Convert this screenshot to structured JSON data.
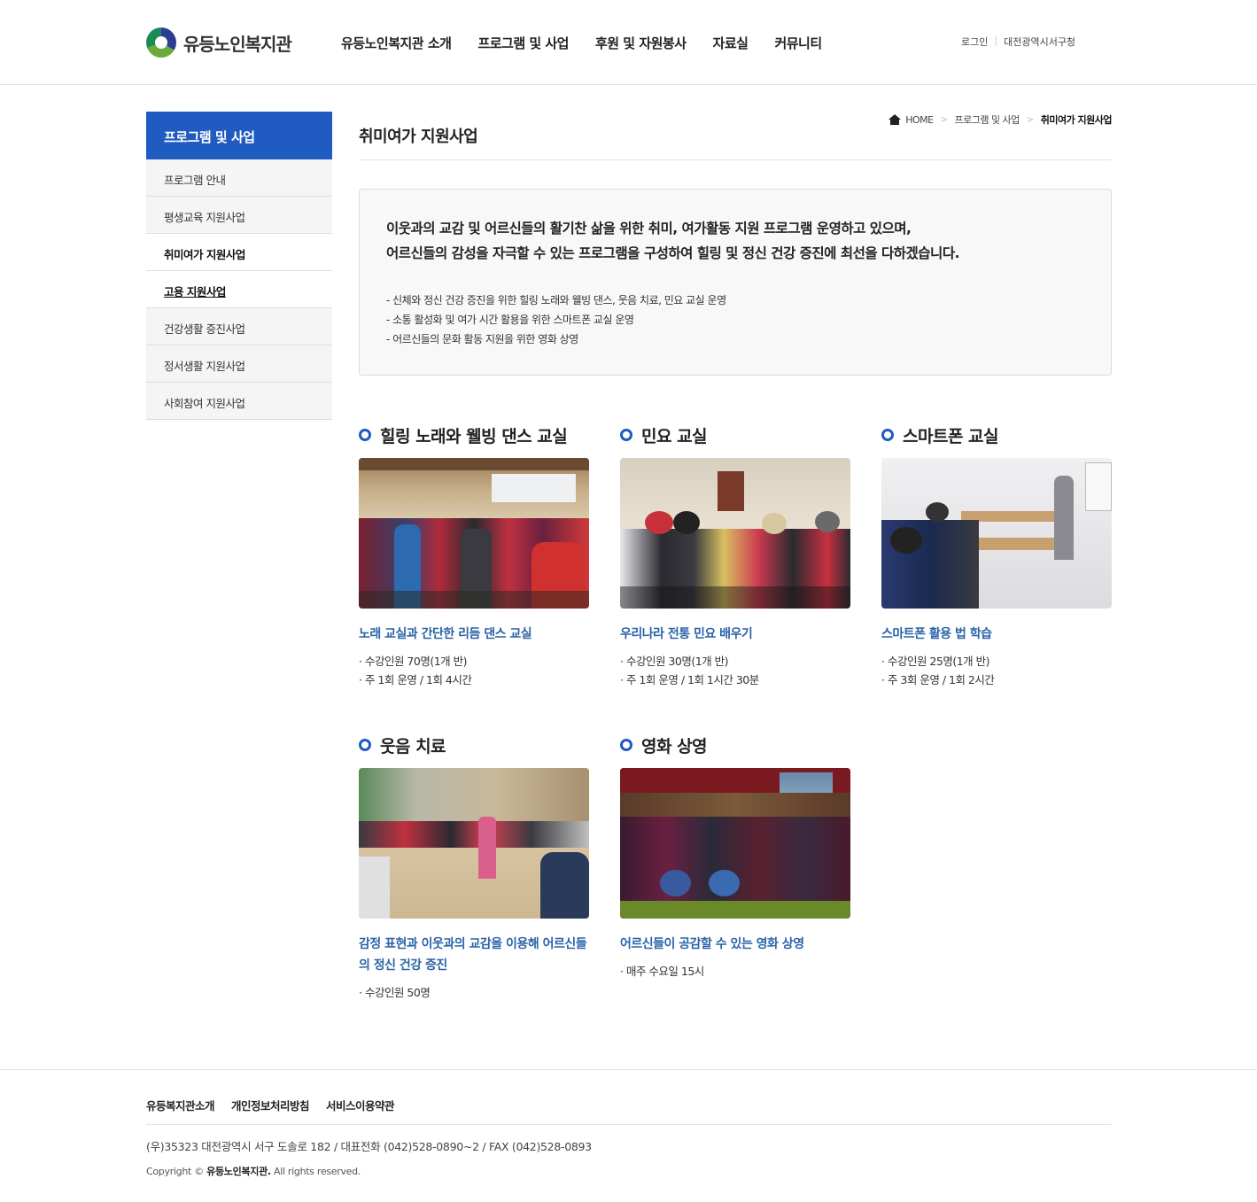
{
  "header": {
    "logo_text": "유등노인복지관",
    "nav": [
      "유등노인복지관 소개",
      "프로그램 및 사업",
      "후원 및 자원봉사",
      "자료실",
      "커뮤니티"
    ],
    "util": {
      "login": "로그인",
      "separator": "|",
      "link": "대전광역시서구청"
    }
  },
  "sidebar": {
    "title": "프로그램 및 사업",
    "items": [
      {
        "label": "프로그램 안내"
      },
      {
        "label": "평생교육 지원사업"
      },
      {
        "label": "취미여가 지원사업"
      },
      {
        "label": "고용 지원사업"
      },
      {
        "label": "건강생활 증진사업"
      },
      {
        "label": "정서생활 지원사업"
      },
      {
        "label": "사회참여 지원사업"
      }
    ]
  },
  "page": {
    "title": "취미여가 지원사업",
    "breadcrumb": {
      "home": "HOME",
      "parent": "프로그램 및 사업",
      "current": "취미여가 지원사업",
      "sep": ">"
    }
  },
  "intro": {
    "lead": [
      "이웃과의 교감 및 어르신들의 활기찬 삶을 위한 취미, 여가활동 지원 프로그램 운영하고 있으며,",
      "어르신들의 감성을 자극할 수 있는 프로그램을 구성하여 힐링 및 정신 건강 증진에 최선을 다하겠습니다."
    ],
    "bullets": [
      "- 신체와 정신 건강 증진을 위한 힐링 노래와 웰빙 댄스, 웃음 치료, 민요 교실 운영",
      "- 소통 활성화 및 여가 시간 활용을 위한 스마트폰 교실 운영",
      "- 어르신들의 문화 활동 지원을 위한 영화 상영"
    ]
  },
  "programs": [
    {
      "title": "힐링 노래와 웰빙 댄스 교실",
      "subtitle": "노래 교실과 간단한 리듬 댄스 교실",
      "info": [
        "· 수강인원 70명(1개 반)",
        "· 주 1회 운영 / 1회 4시간"
      ]
    },
    {
      "title": "민요 교실",
      "subtitle": "우리나라 전통 민요 배우기",
      "info": [
        "· 수강인원 30명(1개 반)",
        "· 주 1회 운영 / 1회 1시간 30분"
      ]
    },
    {
      "title": "스마트폰 교실",
      "subtitle": "스마트폰 활용 법 학습",
      "info": [
        "· 수강인원 25명(1개 반)",
        "· 주 3회 운영 / 1회 2시간"
      ]
    },
    {
      "title": "웃음 치료",
      "subtitle": "감정 표현과 이웃과의 교감을 이용해 어르신들의 정신 건강 증진",
      "info": [
        "· 수강인원 50명"
      ]
    },
    {
      "title": "영화 상영",
      "subtitle": "어르신들이 공감할 수 있는 영화 상영",
      "info": [
        "· 매주 수요일 15시"
      ]
    }
  ],
  "footer": {
    "links": [
      "유등복지관소개",
      "개인정보처리방침",
      "서비스이용약관"
    ],
    "address": "(우)35323 대전광역시 서구 도솔로 182 / 대표전화 (042)528-0890~2 / FAX (042)528-0893",
    "copyright_prefix": "Copyright ©",
    "copyright_name": "유등노인복지관.",
    "copyright_suffix": "All rights reserved."
  },
  "colors": {
    "accent": "#1f5bc0",
    "subtitle": "#2b63a8"
  }
}
